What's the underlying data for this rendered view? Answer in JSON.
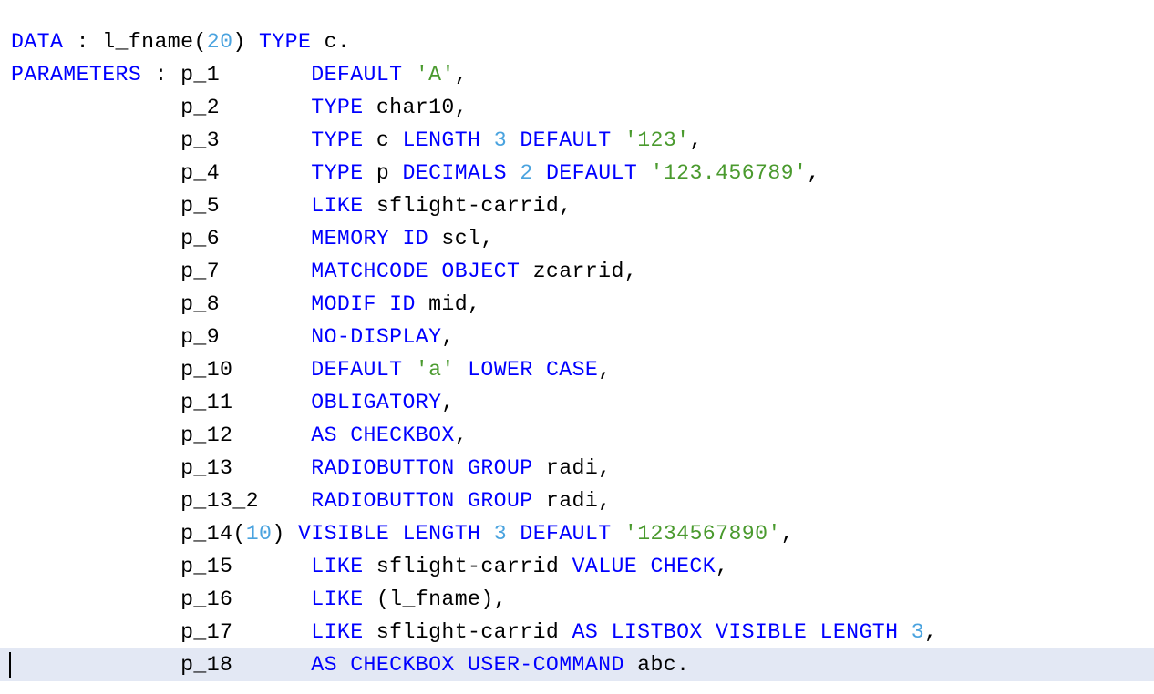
{
  "colors": {
    "keyword": "#0000ff",
    "identifier": "#000000",
    "number": "#4aa3df",
    "string": "#4a9a2e",
    "current_line_highlight": "#e3e8f4",
    "background": "#ffffff"
  },
  "editor": {
    "current_line_index": 19,
    "lines": [
      [
        [
          "kw",
          "DATA"
        ],
        [
          "op",
          " : "
        ],
        [
          "id",
          "l_fname"
        ],
        [
          "op",
          "("
        ],
        [
          "num",
          "20"
        ],
        [
          "op",
          ") "
        ],
        [
          "kw",
          "TYPE"
        ],
        [
          "id",
          " c."
        ]
      ],
      [
        [
          "kw",
          "PARAMETERS"
        ],
        [
          "op",
          " : "
        ],
        [
          "id",
          "p_1       "
        ],
        [
          "kw",
          "DEFAULT"
        ],
        [
          "op",
          " "
        ],
        [
          "str",
          "'A'"
        ],
        [
          "op",
          ","
        ]
      ],
      [
        [
          "id",
          "             p_2       "
        ],
        [
          "kw",
          "TYPE"
        ],
        [
          "id",
          " char10,"
        ]
      ],
      [
        [
          "id",
          "             p_3       "
        ],
        [
          "kw",
          "TYPE"
        ],
        [
          "id",
          " c "
        ],
        [
          "kw",
          "LENGTH"
        ],
        [
          "op",
          " "
        ],
        [
          "num",
          "3"
        ],
        [
          "op",
          " "
        ],
        [
          "kw",
          "DEFAULT"
        ],
        [
          "op",
          " "
        ],
        [
          "str",
          "'123'"
        ],
        [
          "op",
          ","
        ]
      ],
      [
        [
          "id",
          "             p_4       "
        ],
        [
          "kw",
          "TYPE"
        ],
        [
          "id",
          " p "
        ],
        [
          "kw",
          "DECIMALS"
        ],
        [
          "op",
          " "
        ],
        [
          "num",
          "2"
        ],
        [
          "op",
          " "
        ],
        [
          "kw",
          "DEFAULT"
        ],
        [
          "op",
          " "
        ],
        [
          "str",
          "'123.456789'"
        ],
        [
          "op",
          ","
        ]
      ],
      [
        [
          "id",
          "             p_5       "
        ],
        [
          "kw",
          "LIKE"
        ],
        [
          "id",
          " sflight-carrid,"
        ]
      ],
      [
        [
          "id",
          "             p_6       "
        ],
        [
          "kw",
          "MEMORY ID"
        ],
        [
          "id",
          " scl,"
        ]
      ],
      [
        [
          "id",
          "             p_7       "
        ],
        [
          "kw",
          "MATCHCODE OBJECT"
        ],
        [
          "id",
          " zcarrid,"
        ]
      ],
      [
        [
          "id",
          "             p_8       "
        ],
        [
          "kw",
          "MODIF ID"
        ],
        [
          "id",
          " mid,"
        ]
      ],
      [
        [
          "id",
          "             p_9       "
        ],
        [
          "kw",
          "NO-DISPLAY"
        ],
        [
          "op",
          ","
        ]
      ],
      [
        [
          "id",
          "             p_10      "
        ],
        [
          "kw",
          "DEFAULT"
        ],
        [
          "op",
          " "
        ],
        [
          "str",
          "'a'"
        ],
        [
          "op",
          " "
        ],
        [
          "kw",
          "LOWER CASE"
        ],
        [
          "op",
          ","
        ]
      ],
      [
        [
          "id",
          "             p_11      "
        ],
        [
          "kw",
          "OBLIGATORY"
        ],
        [
          "op",
          ","
        ]
      ],
      [
        [
          "id",
          "             p_12      "
        ],
        [
          "kw",
          "AS CHECKBOX"
        ],
        [
          "op",
          ","
        ]
      ],
      [
        [
          "id",
          "             p_13      "
        ],
        [
          "kw",
          "RADIOBUTTON GROUP"
        ],
        [
          "id",
          " radi,"
        ]
      ],
      [
        [
          "id",
          "             p_13_2    "
        ],
        [
          "kw",
          "RADIOBUTTON GROUP"
        ],
        [
          "id",
          " radi,"
        ]
      ],
      [
        [
          "id",
          "             p_14"
        ],
        [
          "op",
          "("
        ],
        [
          "num",
          "10"
        ],
        [
          "op",
          ") "
        ],
        [
          "kw",
          "VISIBLE LENGTH"
        ],
        [
          "op",
          " "
        ],
        [
          "num",
          "3"
        ],
        [
          "op",
          " "
        ],
        [
          "kw",
          "DEFAULT"
        ],
        [
          "op",
          " "
        ],
        [
          "str",
          "'1234567890'"
        ],
        [
          "op",
          ","
        ]
      ],
      [
        [
          "id",
          "             p_15      "
        ],
        [
          "kw",
          "LIKE"
        ],
        [
          "id",
          " sflight-carrid "
        ],
        [
          "kw",
          "VALUE CHECK"
        ],
        [
          "op",
          ","
        ]
      ],
      [
        [
          "id",
          "             p_16      "
        ],
        [
          "kw",
          "LIKE"
        ],
        [
          "op",
          " ("
        ],
        [
          "id",
          "l_fname"
        ],
        [
          "op",
          "),"
        ]
      ],
      [
        [
          "id",
          "             p_17      "
        ],
        [
          "kw",
          "LIKE"
        ],
        [
          "id",
          " sflight-carrid "
        ],
        [
          "kw",
          "AS LISTBOX VISIBLE LENGTH"
        ],
        [
          "op",
          " "
        ],
        [
          "num",
          "3"
        ],
        [
          "op",
          ","
        ]
      ],
      [
        [
          "id",
          "             p_18      "
        ],
        [
          "kw",
          "AS CHECKBOX USER-COMMAND"
        ],
        [
          "id",
          " abc."
        ]
      ]
    ]
  }
}
